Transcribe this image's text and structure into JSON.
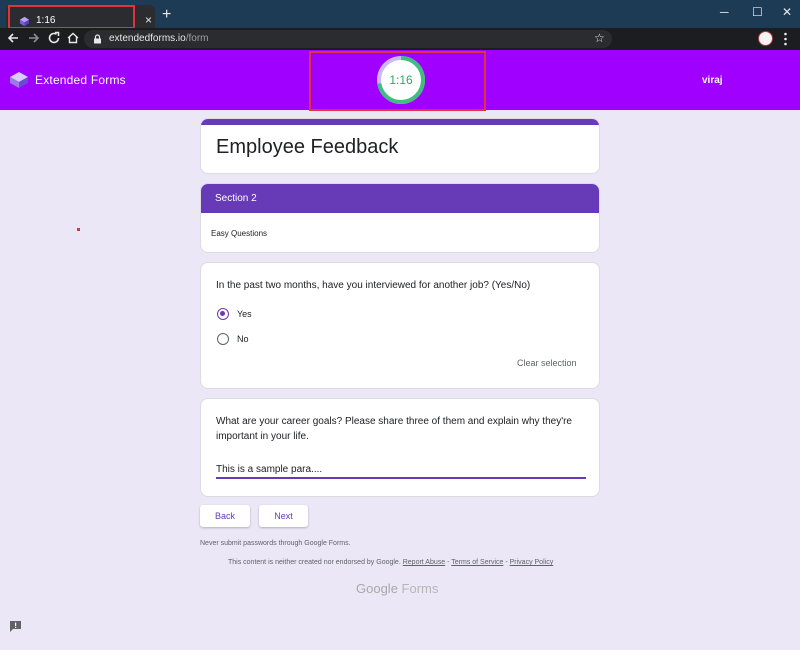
{
  "browser": {
    "tab_title": "1:16",
    "tab_close": "×",
    "new_tab": "+",
    "url_host": "extendedforms.io",
    "url_path": "/form",
    "star": "☆",
    "window_minimize": "─",
    "window_maximize": "☐",
    "window_close": "✕"
  },
  "app": {
    "brand_name": "Extended Forms",
    "timer": "1:16",
    "user_name": "viraj"
  },
  "form": {
    "title": "Employee Feedback",
    "section_title": "Section 2",
    "section_description": "Easy Questions",
    "q1": {
      "text": "In the past two months, have you interviewed for another job? (Yes/No)",
      "options": [
        "Yes",
        "No"
      ],
      "selected": "Yes",
      "clear_label": "Clear selection"
    },
    "q2": {
      "text_line1": "What are your career goals? Please share three of them and explain why they're",
      "text_line2": "important in your life.",
      "answer": "This is a sample para...."
    },
    "back_label": "Back",
    "next_label": "Next"
  },
  "footer": {
    "warning": "Never submit passwords through Google Forms.",
    "disclaimer_prefix": "This content is neither created nor endorsed by Google.",
    "report_abuse": "Report Abuse",
    "terms": "Terms of Service",
    "privacy": "Privacy Policy",
    "sep": " - ",
    "google_word": "Google",
    "forms_word": "Forms"
  },
  "colors": {
    "header_purple": "#a000ff",
    "accent": "#673ab7",
    "timer_green": "#2aa86a",
    "highlight_red": "#e0343a"
  }
}
